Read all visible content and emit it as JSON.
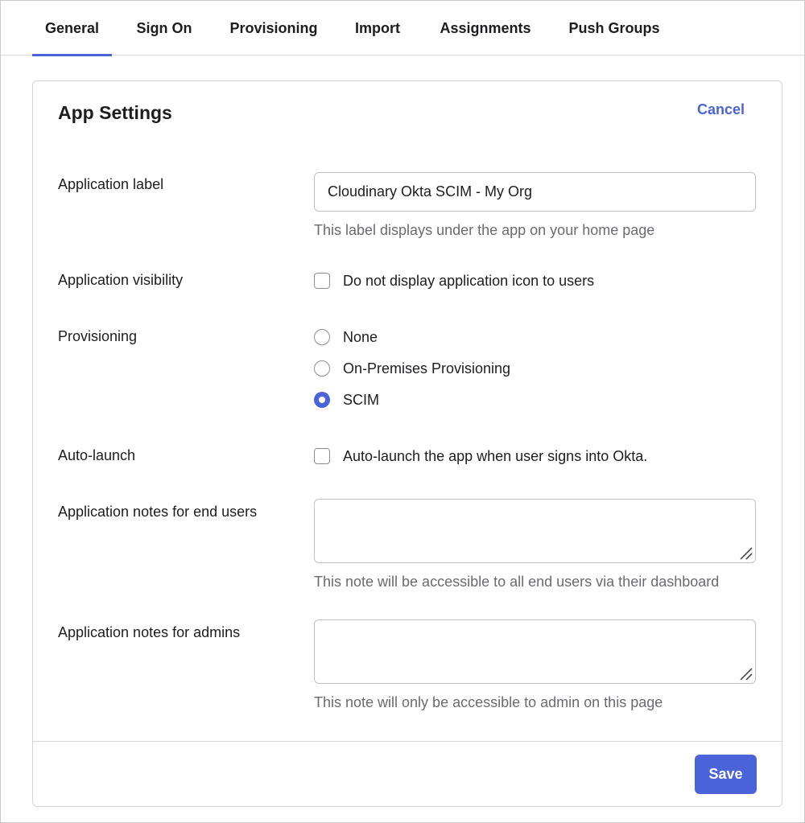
{
  "tabs": [
    {
      "label": "General",
      "active": true
    },
    {
      "label": "Sign On"
    },
    {
      "label": "Provisioning"
    },
    {
      "label": "Import"
    },
    {
      "label": "Assignments"
    },
    {
      "label": "Push Groups"
    }
  ],
  "card": {
    "title": "App Settings",
    "cancel_label": "Cancel",
    "save_label": "Save"
  },
  "fields": {
    "app_label": {
      "label": "Application label",
      "value": "Cloudinary Okta SCIM - My Org",
      "help": "This label displays under the app on your home page"
    },
    "visibility": {
      "label": "Application visibility",
      "option": "Do not display application icon to users",
      "checked": false
    },
    "provisioning": {
      "label": "Provisioning",
      "options": [
        {
          "label": "None",
          "selected": false
        },
        {
          "label": "On-Premises Provisioning",
          "selected": false
        },
        {
          "label": "SCIM",
          "selected": true
        }
      ]
    },
    "auto_launch": {
      "label": "Auto-launch",
      "option": "Auto-launch the app when user signs into Okta.",
      "checked": false
    },
    "notes_end_users": {
      "label": "Application notes for end users",
      "value": "",
      "help": "This note will be accessible to all end users via their dashboard"
    },
    "notes_admins": {
      "label": "Application notes for admins",
      "value": "",
      "help": "This note will only be accessible to admin on this page"
    }
  },
  "colors": {
    "accent": "#4b63d8"
  }
}
